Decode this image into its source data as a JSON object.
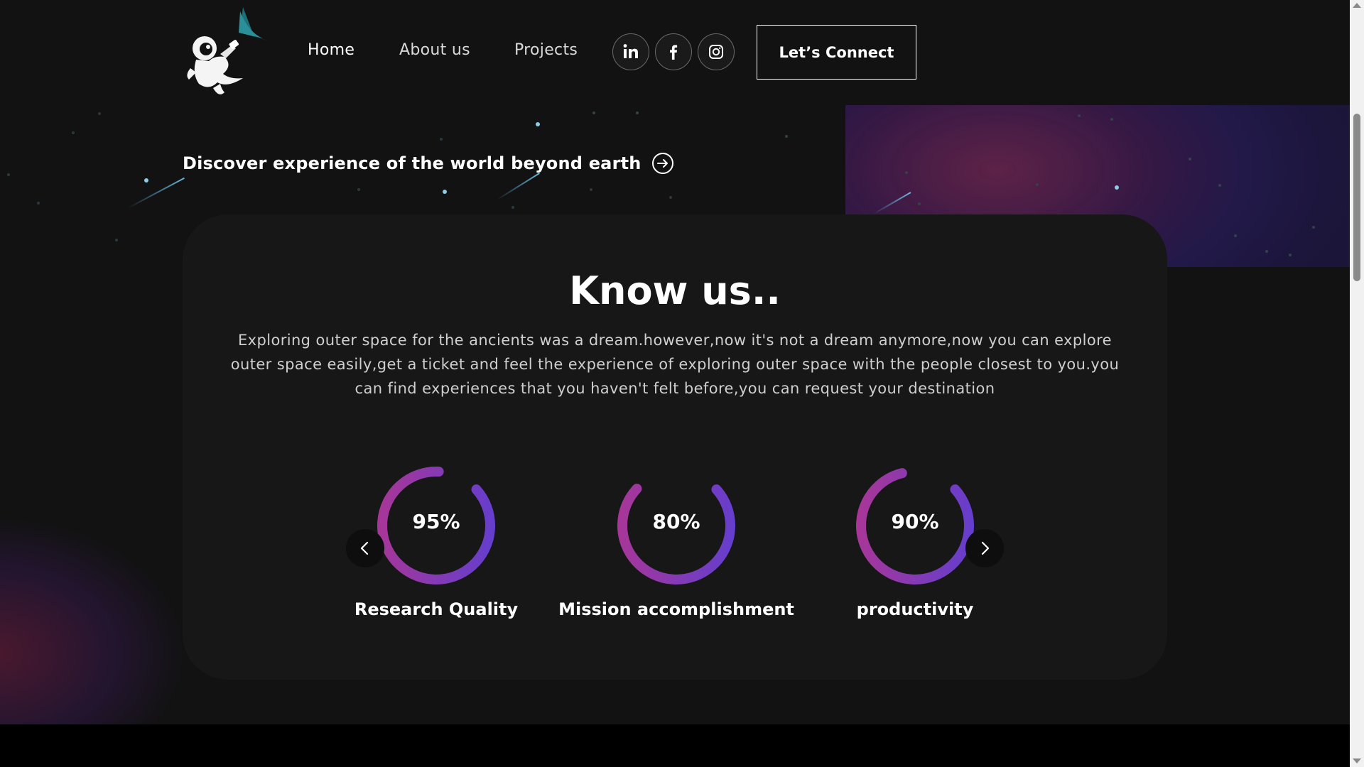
{
  "nav": {
    "logo_icon": "astronaut-logo",
    "links": [
      {
        "label": "Home",
        "active": true
      },
      {
        "label": "About us",
        "active": false
      },
      {
        "label": "Projects",
        "active": false
      }
    ],
    "social": [
      {
        "name": "linkedin-icon",
        "glyph": "in"
      },
      {
        "name": "facebook-icon",
        "glyph": "f"
      },
      {
        "name": "instagram-icon",
        "glyph": ""
      }
    ],
    "cta_label": "Let’s Connect"
  },
  "hero": {
    "tagline": "Discover experience of the world beyond earth",
    "tagline_icon": "arrow-right-circle-icon"
  },
  "about": {
    "title": "Know us..",
    "description": "Exploring outer space for the ancients was a dream.however,now it's not a dream anymore,now you can explore outer space easily,get a ticket and feel the experience of exploring outer space with the people closest to you.you can find experiences that you haven't felt before,you can request your destination",
    "stats": [
      {
        "percent_label": "95%",
        "value": 95,
        "label": "Research Quality"
      },
      {
        "percent_label": "80%",
        "value": 80,
        "label": "Mission accomplishment"
      },
      {
        "percent_label": "90%",
        "value": 90,
        "label": "productivity"
      }
    ],
    "prev_icon": "chevron-left-icon",
    "next_icon": "chevron-right-icon"
  },
  "colors": {
    "background": "#121212",
    "card": "#171717",
    "ring_start": "#b3358f",
    "ring_end": "#5a3fd6",
    "accent_blue": "#6ec8f0"
  }
}
